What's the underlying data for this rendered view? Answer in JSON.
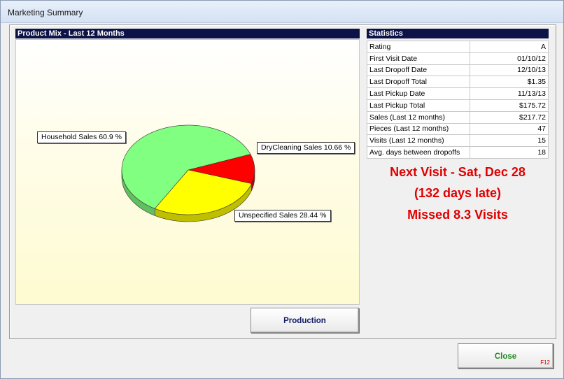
{
  "window": {
    "title": "Marketing Summary"
  },
  "chart_panel": {
    "header": "Product Mix - Last 12 Months"
  },
  "chart_data": {
    "type": "pie",
    "title": "Product Mix - Last 12 Months",
    "series": [
      {
        "name": "Household Sales",
        "value": 60.9,
        "label": "Household Sales 60.9 %",
        "color": "#80ff80"
      },
      {
        "name": "DryCleaning Sales",
        "value": 10.66,
        "label": "DryCleaning Sales 10.66 %",
        "color": "#ff0000"
      },
      {
        "name": "Unspecified Sales",
        "value": 28.44,
        "label": "Unspecified Sales 28.44 %",
        "color": "#ffff00"
      }
    ]
  },
  "stats_panel": {
    "header": "Statistics",
    "rows": [
      {
        "label": "Rating",
        "value": "A"
      },
      {
        "label": "First Visit Date",
        "value": "01/10/12"
      },
      {
        "label": "Last Dropoff Date",
        "value": "12/10/13"
      },
      {
        "label": "Last Dropoff Total",
        "value": "$1.35"
      },
      {
        "label": "Last Pickup Date",
        "value": "11/13/13"
      },
      {
        "label": "Last Pickup Total",
        "value": "$175.72"
      },
      {
        "label": "Sales (Last 12 months)",
        "value": "$217.72"
      },
      {
        "label": "Pieces (Last 12 months)",
        "value": "47"
      },
      {
        "label": "Visits (Last 12 months)",
        "value": "15"
      },
      {
        "label": "Avg. days between dropoffs",
        "value": "18"
      }
    ]
  },
  "alerts": {
    "next_visit": "Next Visit - Sat, Dec 28",
    "days_late": "(132 days late)",
    "missed": "Missed 8.3 Visits",
    "color": "#e00000"
  },
  "buttons": {
    "production": "Production",
    "close": "Close",
    "close_shortcut": "F12"
  }
}
